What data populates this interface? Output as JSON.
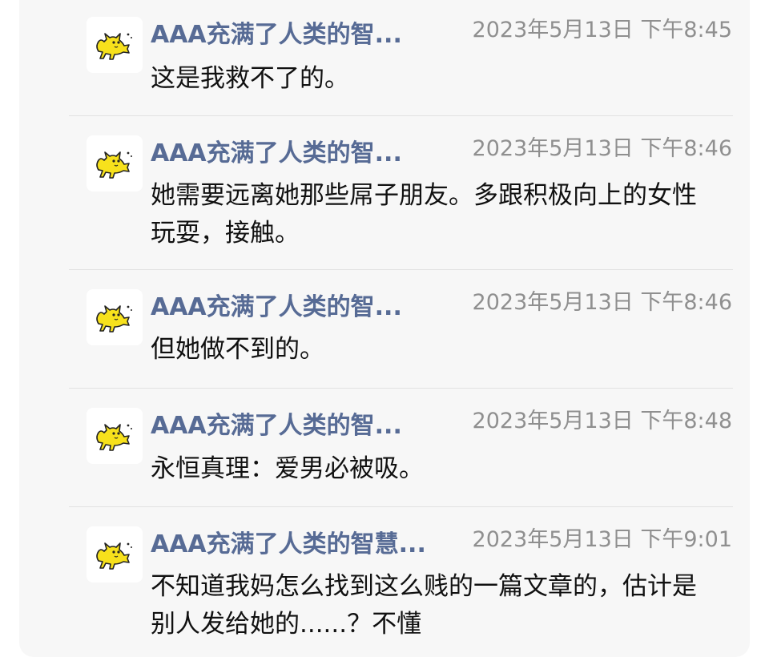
{
  "messages": [
    {
      "sender": "AAA充满了人类的智...",
      "time": "2023年5月13日 下午8:45",
      "text": "这是我救不了的。",
      "avatar_icon": "yellow-cat-icon"
    },
    {
      "sender": "AAA充满了人类的智...",
      "time": "2023年5月13日 下午8:46",
      "text": "她需要远离她那些屌子朋友。多跟积极向上的女性玩耍，接触。",
      "avatar_icon": "yellow-cat-icon"
    },
    {
      "sender": "AAA充满了人类的智...",
      "time": "2023年5月13日 下午8:46",
      "text": "但她做不到的。",
      "avatar_icon": "yellow-cat-icon"
    },
    {
      "sender": "AAA充满了人类的智...",
      "time": "2023年5月13日 下午8:48",
      "text": "永恒真理：爱男必被吸。",
      "avatar_icon": "yellow-cat-icon"
    },
    {
      "sender": "AAA充满了人类的智慧...",
      "time": "2023年5月13日 下午9:01",
      "text": "不知道我妈怎么找到这么贱的一篇文章的，估计是别人发给她的......？不懂",
      "avatar_icon": "yellow-cat-icon"
    }
  ],
  "colors": {
    "sender_name": "#576b95",
    "timestamp": "#8f8f8f",
    "panel_background": "#f7f7f7",
    "avatar_cat": "#f7e11c"
  }
}
